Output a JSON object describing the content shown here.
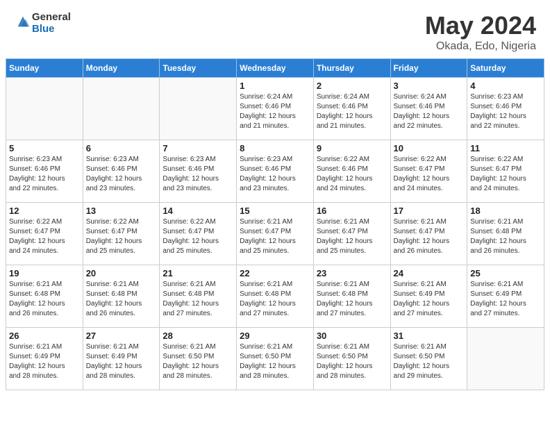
{
  "header": {
    "logo_general": "General",
    "logo_blue": "Blue",
    "month_title": "May 2024",
    "location": "Okada, Edo, Nigeria"
  },
  "calendar": {
    "days_of_week": [
      "Sunday",
      "Monday",
      "Tuesday",
      "Wednesday",
      "Thursday",
      "Friday",
      "Saturday"
    ],
    "weeks": [
      [
        {
          "day": "",
          "info": ""
        },
        {
          "day": "",
          "info": ""
        },
        {
          "day": "",
          "info": ""
        },
        {
          "day": "1",
          "info": "Sunrise: 6:24 AM\nSunset: 6:46 PM\nDaylight: 12 hours\nand 21 minutes."
        },
        {
          "day": "2",
          "info": "Sunrise: 6:24 AM\nSunset: 6:46 PM\nDaylight: 12 hours\nand 21 minutes."
        },
        {
          "day": "3",
          "info": "Sunrise: 6:24 AM\nSunset: 6:46 PM\nDaylight: 12 hours\nand 22 minutes."
        },
        {
          "day": "4",
          "info": "Sunrise: 6:23 AM\nSunset: 6:46 PM\nDaylight: 12 hours\nand 22 minutes."
        }
      ],
      [
        {
          "day": "5",
          "info": "Sunrise: 6:23 AM\nSunset: 6:46 PM\nDaylight: 12 hours\nand 22 minutes."
        },
        {
          "day": "6",
          "info": "Sunrise: 6:23 AM\nSunset: 6:46 PM\nDaylight: 12 hours\nand 23 minutes."
        },
        {
          "day": "7",
          "info": "Sunrise: 6:23 AM\nSunset: 6:46 PM\nDaylight: 12 hours\nand 23 minutes."
        },
        {
          "day": "8",
          "info": "Sunrise: 6:23 AM\nSunset: 6:46 PM\nDaylight: 12 hours\nand 23 minutes."
        },
        {
          "day": "9",
          "info": "Sunrise: 6:22 AM\nSunset: 6:46 PM\nDaylight: 12 hours\nand 24 minutes."
        },
        {
          "day": "10",
          "info": "Sunrise: 6:22 AM\nSunset: 6:47 PM\nDaylight: 12 hours\nand 24 minutes."
        },
        {
          "day": "11",
          "info": "Sunrise: 6:22 AM\nSunset: 6:47 PM\nDaylight: 12 hours\nand 24 minutes."
        }
      ],
      [
        {
          "day": "12",
          "info": "Sunrise: 6:22 AM\nSunset: 6:47 PM\nDaylight: 12 hours\nand 24 minutes."
        },
        {
          "day": "13",
          "info": "Sunrise: 6:22 AM\nSunset: 6:47 PM\nDaylight: 12 hours\nand 25 minutes."
        },
        {
          "day": "14",
          "info": "Sunrise: 6:22 AM\nSunset: 6:47 PM\nDaylight: 12 hours\nand 25 minutes."
        },
        {
          "day": "15",
          "info": "Sunrise: 6:21 AM\nSunset: 6:47 PM\nDaylight: 12 hours\nand 25 minutes."
        },
        {
          "day": "16",
          "info": "Sunrise: 6:21 AM\nSunset: 6:47 PM\nDaylight: 12 hours\nand 25 minutes."
        },
        {
          "day": "17",
          "info": "Sunrise: 6:21 AM\nSunset: 6:47 PM\nDaylight: 12 hours\nand 26 minutes."
        },
        {
          "day": "18",
          "info": "Sunrise: 6:21 AM\nSunset: 6:48 PM\nDaylight: 12 hours\nand 26 minutes."
        }
      ],
      [
        {
          "day": "19",
          "info": "Sunrise: 6:21 AM\nSunset: 6:48 PM\nDaylight: 12 hours\nand 26 minutes."
        },
        {
          "day": "20",
          "info": "Sunrise: 6:21 AM\nSunset: 6:48 PM\nDaylight: 12 hours\nand 26 minutes."
        },
        {
          "day": "21",
          "info": "Sunrise: 6:21 AM\nSunset: 6:48 PM\nDaylight: 12 hours\nand 27 minutes."
        },
        {
          "day": "22",
          "info": "Sunrise: 6:21 AM\nSunset: 6:48 PM\nDaylight: 12 hours\nand 27 minutes."
        },
        {
          "day": "23",
          "info": "Sunrise: 6:21 AM\nSunset: 6:48 PM\nDaylight: 12 hours\nand 27 minutes."
        },
        {
          "day": "24",
          "info": "Sunrise: 6:21 AM\nSunset: 6:49 PM\nDaylight: 12 hours\nand 27 minutes."
        },
        {
          "day": "25",
          "info": "Sunrise: 6:21 AM\nSunset: 6:49 PM\nDaylight: 12 hours\nand 27 minutes."
        }
      ],
      [
        {
          "day": "26",
          "info": "Sunrise: 6:21 AM\nSunset: 6:49 PM\nDaylight: 12 hours\nand 28 minutes."
        },
        {
          "day": "27",
          "info": "Sunrise: 6:21 AM\nSunset: 6:49 PM\nDaylight: 12 hours\nand 28 minutes."
        },
        {
          "day": "28",
          "info": "Sunrise: 6:21 AM\nSunset: 6:50 PM\nDaylight: 12 hours\nand 28 minutes."
        },
        {
          "day": "29",
          "info": "Sunrise: 6:21 AM\nSunset: 6:50 PM\nDaylight: 12 hours\nand 28 minutes."
        },
        {
          "day": "30",
          "info": "Sunrise: 6:21 AM\nSunset: 6:50 PM\nDaylight: 12 hours\nand 28 minutes."
        },
        {
          "day": "31",
          "info": "Sunrise: 6:21 AM\nSunset: 6:50 PM\nDaylight: 12 hours\nand 29 minutes."
        },
        {
          "day": "",
          "info": ""
        }
      ]
    ]
  }
}
